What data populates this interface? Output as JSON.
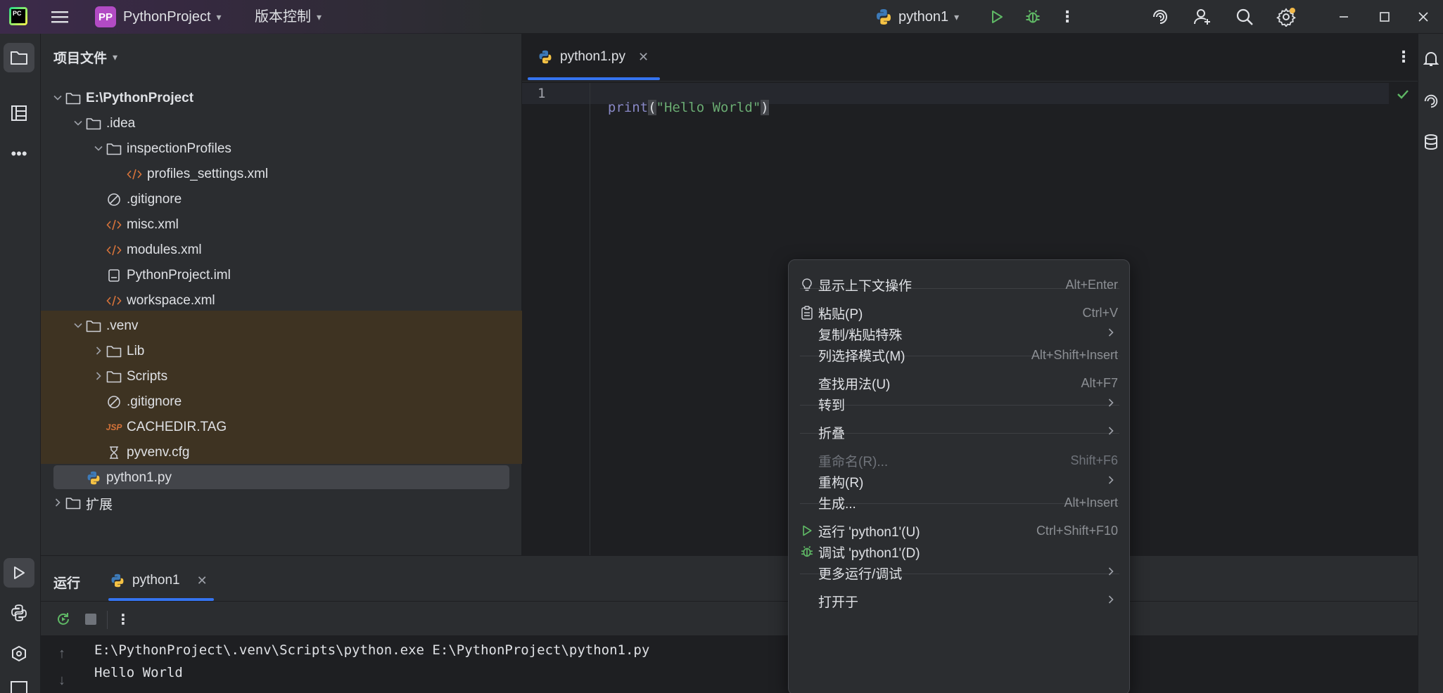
{
  "titlebar": {
    "app_logo": "PC",
    "menu_icon": "hamburger-menu-icon",
    "project_badge": "PP",
    "project_name": "PythonProject",
    "vcs_label": "版本控制",
    "run_config": "python1"
  },
  "project_panel": {
    "title": "项目文件",
    "tree": [
      {
        "label": "E:\\PythonProject",
        "depth": 0,
        "type": "folder",
        "expanded": true,
        "bold": true
      },
      {
        "label": ".idea",
        "depth": 1,
        "type": "folder",
        "expanded": true
      },
      {
        "label": "inspectionProfiles",
        "depth": 2,
        "type": "folder",
        "expanded": true
      },
      {
        "label": "profiles_settings.xml",
        "depth": 3,
        "type": "xml"
      },
      {
        "label": ".gitignore",
        "depth": 2,
        "type": "ignore"
      },
      {
        "label": "misc.xml",
        "depth": 2,
        "type": "xml"
      },
      {
        "label": "modules.xml",
        "depth": 2,
        "type": "xml"
      },
      {
        "label": "PythonProject.iml",
        "depth": 2,
        "type": "iml"
      },
      {
        "label": "workspace.xml",
        "depth": 2,
        "type": "xml"
      },
      {
        "label": ".venv",
        "depth": 1,
        "type": "folder",
        "expanded": true,
        "excluded": true
      },
      {
        "label": "Lib",
        "depth": 2,
        "type": "folder",
        "expanded": false,
        "excluded": true
      },
      {
        "label": "Scripts",
        "depth": 2,
        "type": "folder",
        "expanded": false,
        "excluded": true
      },
      {
        "label": ".gitignore",
        "depth": 2,
        "type": "ignore",
        "excluded": true
      },
      {
        "label": "CACHEDIR.TAG",
        "depth": 2,
        "type": "tag",
        "excluded": true
      },
      {
        "label": "pyvenv.cfg",
        "depth": 2,
        "type": "cfg",
        "excluded": true
      },
      {
        "label": "python1.py",
        "depth": 1,
        "type": "python",
        "selected": true
      },
      {
        "label": "扩展",
        "depth": 0,
        "type": "folder",
        "expanded": false
      }
    ]
  },
  "editor": {
    "tab_label": "python1.py",
    "line_number": "1",
    "code": {
      "fn": "print",
      "open": "(",
      "str": "\"Hello World\"",
      "close": ")"
    }
  },
  "run_panel": {
    "title": "运行",
    "tab_label": "python1",
    "console_lines": [
      "E:\\PythonProject\\.venv\\Scripts\\python.exe E:\\PythonProject\\python1.py",
      "Hello World"
    ]
  },
  "context_menu": {
    "items": [
      {
        "label": "显示上下文操作",
        "shortcut": "Alt+Enter",
        "icon": "bulb"
      },
      {
        "label": "粘贴(P)",
        "shortcut": "Ctrl+V",
        "icon": "clipboard"
      },
      {
        "label": "复制/粘贴特殊",
        "shortcut": "",
        "submenu": true
      },
      {
        "label": "列选择模式(M)",
        "shortcut": "Alt+Shift+Insert"
      },
      {
        "label": "查找用法(U)",
        "shortcut": "Alt+F7"
      },
      {
        "label": "转到",
        "shortcut": "",
        "submenu": true
      },
      {
        "label": "折叠",
        "shortcut": "",
        "submenu": true
      },
      {
        "label": "重命名(R)...",
        "shortcut": "Shift+F6",
        "disabled": true
      },
      {
        "label": "重构(R)",
        "shortcut": "",
        "submenu": true
      },
      {
        "label": "生成...",
        "shortcut": "Alt+Insert"
      },
      {
        "label": "运行 'python1'(U)",
        "shortcut": "Ctrl+Shift+F10",
        "icon": "run"
      },
      {
        "label": "调试 'python1'(D)",
        "shortcut": "",
        "icon": "debug"
      },
      {
        "label": "更多运行/调试",
        "shortcut": "",
        "submenu": true
      },
      {
        "label": "打开于",
        "shortcut": "",
        "submenu": true
      }
    ]
  },
  "colors": {
    "accent_run": "#5fb865",
    "python_blue": "#3d7ab8",
    "python_yellow": "#f5c244",
    "string_green": "#6aab73",
    "keyword_purple": "#c77dbb",
    "xml_orange": "#d6733a",
    "excluded_bg": "#3e3322"
  }
}
